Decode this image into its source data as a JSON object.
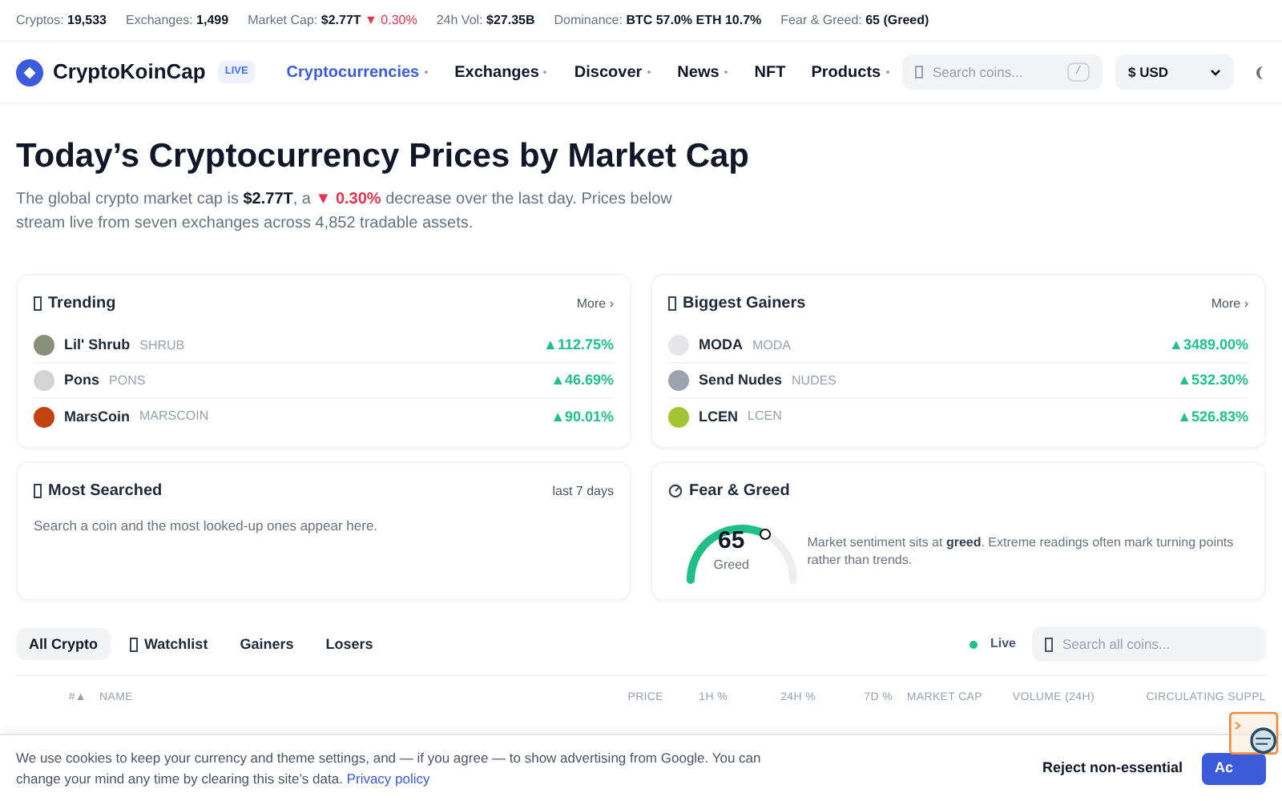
{
  "ticker": [
    {
      "label": "Cryptos:",
      "value": "19,533"
    },
    {
      "label": "Exchanges:",
      "value": "1,499"
    },
    {
      "label": "Market Cap:",
      "value": "$2.77T",
      "change": "▼ 0.30%"
    },
    {
      "label": "24h Vol:",
      "value": "$27.35B"
    },
    {
      "label": "Dominance:",
      "value": "BTC 57.0% ETH 10.7%"
    },
    {
      "label": "Fear & Greed:",
      "value": "65 (Greed)"
    }
  ],
  "nav": {
    "brand": "CryptoKoinCap",
    "badge": "LIVE",
    "links": [
      {
        "label": "Cryptocurrencies",
        "selected": true,
        "dropdown": true
      },
      {
        "label": "Exchanges",
        "selected": false,
        "dropdown": true
      },
      {
        "label": "Discover",
        "selected": false,
        "dropdown": true
      },
      {
        "label": "News",
        "selected": false,
        "dropdown": true
      },
      {
        "label": "NFT",
        "selected": false,
        "dropdown": false
      },
      {
        "label": "Products",
        "selected": false,
        "dropdown": true
      }
    ],
    "search": {
      "placeholder": "Search coins...",
      "shortcut": "/"
    },
    "currency": "$ USD"
  },
  "title": "Today’s Cryptocurrency Prices by Market Cap",
  "summary": {
    "prefix": "The global crypto market cap is ",
    "cap": "$2.77T",
    "mid": ", a ",
    "change": "▼ 0.30%",
    "suffix": " decrease over the last day. Prices below stream live from seven exchanges across 4,852 tradable assets."
  },
  "cards": [
    {
      "kind": "list",
      "title": "Trending",
      "action": "More ›",
      "items": [
        {
          "name": "Lil' Shrub",
          "symbol": "SHRUB",
          "change": "▲112.75%",
          "color": "#8a8f7a"
        },
        {
          "name": "Pons",
          "symbol": "PONS",
          "change": "▲46.69%",
          "color": "#d4d4d4"
        },
        {
          "name": "MarsCoin",
          "symbol": "MARSCOIN",
          "change": "▲90.01%",
          "color": "#c2410c"
        }
      ]
    },
    {
      "kind": "list",
      "title": "Biggest Gainers",
      "action": "More ›",
      "items": [
        {
          "name": "MODA",
          "symbol": "MODA",
          "change": "▲3489.00%",
          "color": "#e5e7eb"
        },
        {
          "name": "Send Nudes",
          "symbol": "NUDES",
          "change": "▲532.30%",
          "color": "#9ca3af"
        },
        {
          "name": "LCEN",
          "symbol": "LCEN",
          "change": "▲526.83%",
          "color": "#a3c531"
        }
      ]
    },
    {
      "kind": "empty",
      "title": "Most Searched",
      "action": "last 7 days",
      "message": "Search a coin and the most looked-up ones appear here."
    },
    {
      "kind": "gauge",
      "title": "Fear & Greed",
      "value": "65",
      "label": "Greed",
      "level": 0.65,
      "note_prefix": "Market sentiment sits at ",
      "note_bold": "greed",
      "note_suffix": ". Extreme readings often mark turning points rather than trends."
    }
  ],
  "tabs": [
    {
      "label": "All Crypto",
      "selected": true,
      "icon": false
    },
    {
      "label": "Watchlist",
      "selected": false,
      "icon": true
    },
    {
      "label": "Gainers",
      "selected": false,
      "icon": false
    },
    {
      "label": "Losers",
      "selected": false,
      "icon": false
    }
  ],
  "live": "Live",
  "table_search": {
    "placeholder": "Search all coins..."
  },
  "columns": [
    "#▲",
    "NAME",
    "PRICE",
    "1H %",
    "24H %",
    "7D %",
    "MARKET CAP",
    "VOLUME (24H)",
    "CIRCULATING SUPPL"
  ],
  "cookie": {
    "text": "We use cookies to keep your currency and theme settings, and — if you agree — to show advertising from Google. You can change your mind any time by clearing this site’s data. ",
    "link": "Privacy policy",
    "reject": "Reject non-essential",
    "accept": "Ac"
  }
}
